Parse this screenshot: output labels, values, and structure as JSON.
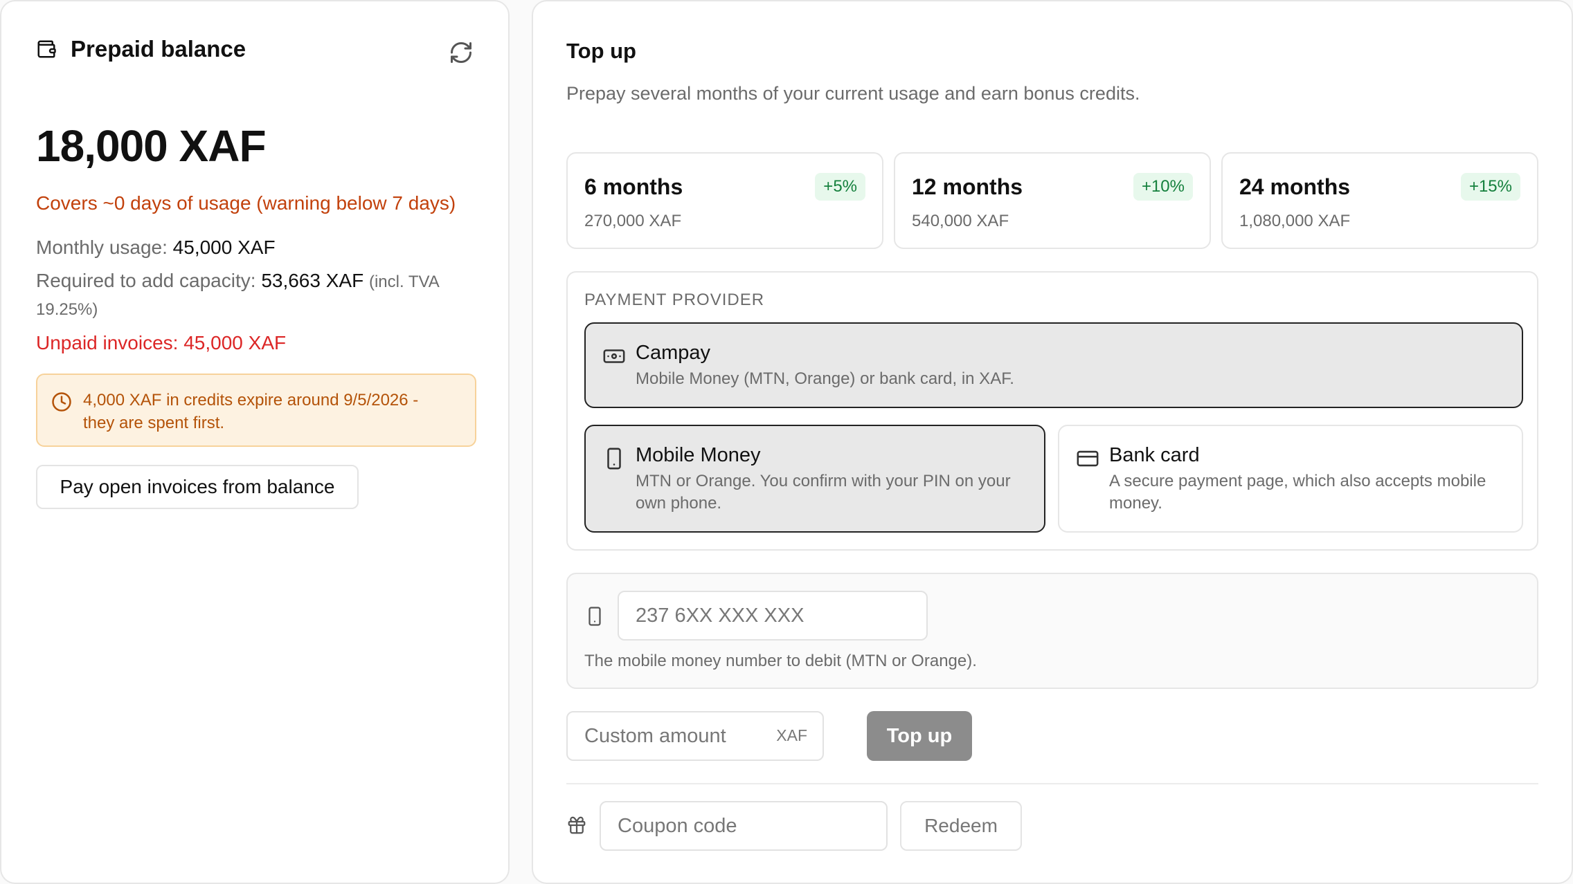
{
  "balance_card": {
    "title": "Prepaid balance",
    "amount": "18,000 XAF",
    "covers": "Covers ~0 days of usage (warning below 7 days)",
    "monthly_usage_label": "Monthly usage:",
    "monthly_usage_value": "45,000 XAF",
    "required_label": "Required to add capacity:",
    "required_value": "53,663 XAF",
    "required_note_1": "(incl. TVA",
    "required_note_2": "19.25%)",
    "unpaid": "Unpaid invoices: 45,000 XAF",
    "notice_line_1": "4,000 XAF in credits expire around 9/5/2026 -",
    "notice_line_2": "they are spent first.",
    "pay_button": "Pay open invoices from balance"
  },
  "topup_card": {
    "title": "Top up",
    "subtitle": "Prepay several months of your current usage and earn bonus credits.",
    "plans": [
      {
        "name": "6 months",
        "price": "270,000 XAF",
        "bonus": "+5%"
      },
      {
        "name": "12 months",
        "price": "540,000 XAF",
        "bonus": "+10%"
      },
      {
        "name": "24 months",
        "price": "1,080,000 XAF",
        "bonus": "+15%"
      }
    ],
    "provider_label": "PAYMENT PROVIDER",
    "providers": [
      {
        "name": "Campay",
        "desc_1": "Mobile Money (MTN, Orange) or bank card, in XAF.",
        "selected": true,
        "icon": "cash-icon"
      },
      {
        "name": "Mobile Money",
        "desc_1": "MTN or Orange. You confirm with your PIN on your",
        "desc_2": "own phone.",
        "selected": true,
        "icon": "phone-icon"
      },
      {
        "name": "Bank card",
        "desc_1": "A secure payment page, which also accepts mobile",
        "desc_2": "money.",
        "selected": false,
        "icon": "credit-card-icon"
      }
    ],
    "phone_placeholder": "237 6XX XXX XXX",
    "phone_help": "The mobile money number to debit (MTN or Orange).",
    "amount_placeholder": "Custom amount",
    "amount_suffix": "XAF",
    "topup_button": "Top up",
    "coupon_placeholder": "Coupon code",
    "redeem_button": "Redeem"
  },
  "colors": {
    "warning_text": "#c2410c",
    "danger_text": "#dc2626",
    "bonus_green": "#15803d",
    "notice_bg": "#fdf2e1"
  }
}
